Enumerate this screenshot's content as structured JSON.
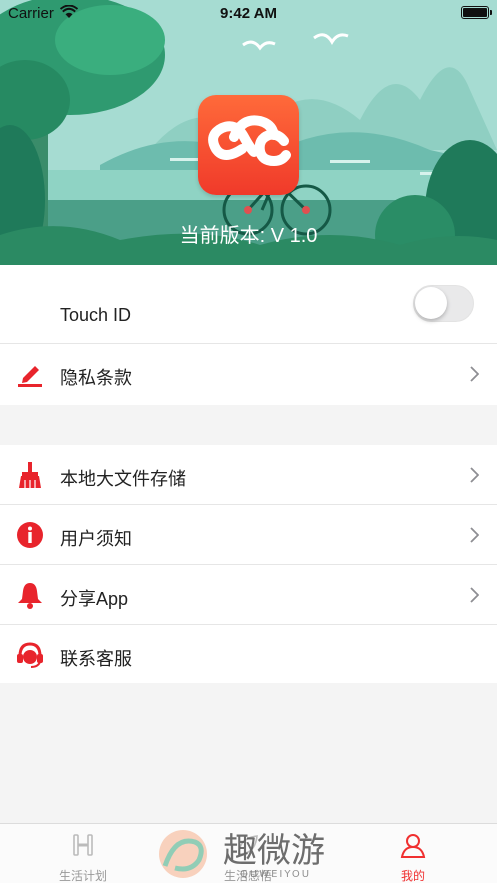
{
  "status_bar": {
    "carrier": "Carrier",
    "time": "9:42 AM"
  },
  "header": {
    "app_icon": "ec-logo-icon",
    "version_text": "当前版本: V 1.0"
  },
  "settings": {
    "group1": [
      {
        "label": "Touch ID",
        "icon": "none",
        "control": "toggle",
        "toggle_on": false
      },
      {
        "label": "隐私条款",
        "icon": "pen-icon",
        "control": "chevron"
      }
    ],
    "group2": [
      {
        "label": "本地大文件存储",
        "icon": "broom-icon",
        "control": "chevron"
      },
      {
        "label": "用户须知",
        "icon": "info-icon",
        "control": "chevron"
      },
      {
        "label": "分享App",
        "icon": "bell-icon",
        "control": "chevron"
      },
      {
        "label": "联系客服",
        "icon": "headset-icon",
        "control": "none"
      }
    ]
  },
  "tabbar": {
    "tabs": [
      {
        "label": "生活计划",
        "icon": "dumbbell-icon",
        "active": false
      },
      {
        "label": "生活感悟",
        "icon": "leaf-icon",
        "active": false
      },
      {
        "label": "我的",
        "icon": "person-icon",
        "active": true
      }
    ]
  },
  "watermark": {
    "text": "趣微游",
    "subtext": "QUWEIYOU"
  },
  "colors": {
    "accent": "#f03030",
    "banner_bg": "#a8ddd3",
    "list_bg": "#ffffff",
    "page_bg": "#f4f4f4"
  }
}
